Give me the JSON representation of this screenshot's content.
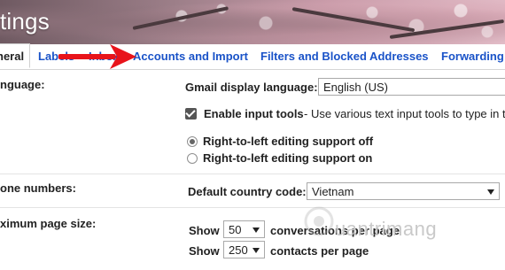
{
  "header": {
    "title": "tings"
  },
  "tabs": [
    {
      "label": "neral",
      "active": true
    },
    {
      "label": "Labels",
      "active": false
    },
    {
      "label": "Inbox",
      "active": false
    },
    {
      "label": "Accounts and Import",
      "active": false
    },
    {
      "label": "Filters and Blocked Addresses",
      "active": false
    },
    {
      "label": "Forwarding",
      "active": false
    }
  ],
  "language": {
    "section_label": "nguage:",
    "display_language_label": "Gmail display language:",
    "display_language_value": "English (US)",
    "input_tools_label": "Enable input tools",
    "input_tools_desc": "- Use various text input tools to type in th",
    "input_tools_checked": true,
    "rtl_off_label": "Right-to-left editing support off",
    "rtl_on_label": "Right-to-left editing support on",
    "rtl_selected": "off"
  },
  "phone": {
    "section_label": "one numbers:",
    "country_label": "Default country code:",
    "country_value": "Vietnam"
  },
  "page_size": {
    "section_label": "ximum page size:",
    "show_label_1": "Show",
    "conversations_value": "50",
    "conversations_label": "conversations per page",
    "show_label_2": "Show",
    "contacts_value": "250",
    "contacts_label": "contacts per page"
  },
  "watermark": {
    "text": "uantrimang"
  },
  "colors": {
    "link_blue": "#1a53c8",
    "annotation_red": "#e8141b"
  }
}
